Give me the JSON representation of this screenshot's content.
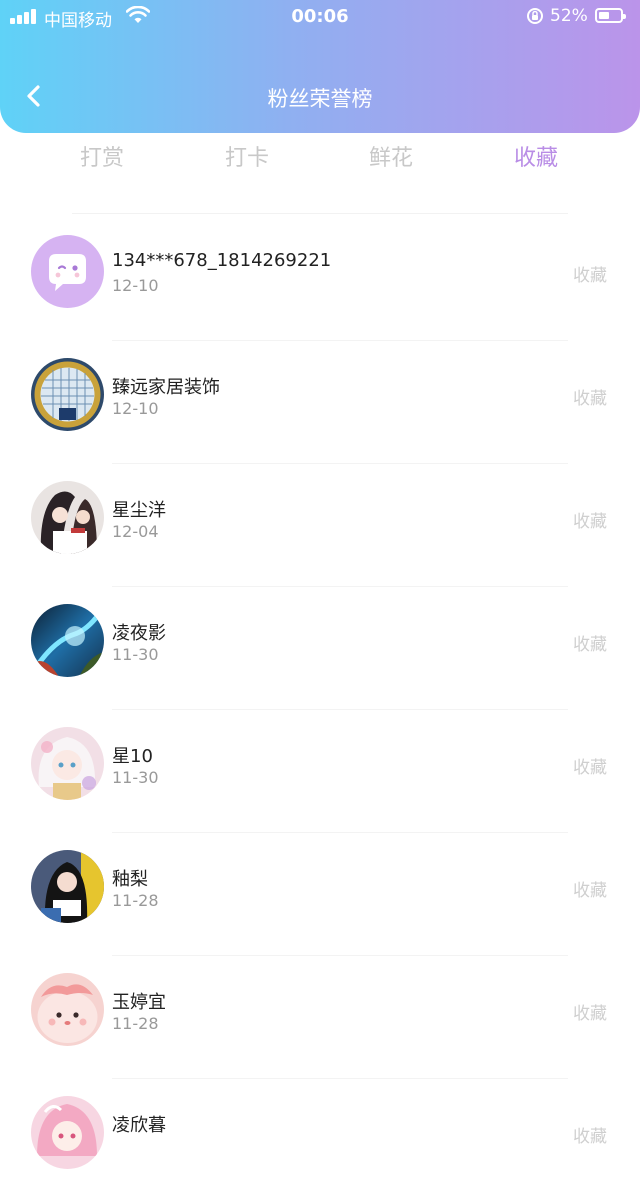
{
  "status_bar": {
    "carrier": "中国移动",
    "time": "00:06",
    "battery_percent": "52%",
    "battery_level": 0.52
  },
  "header": {
    "title": "粉丝荣誉榜",
    "back_icon": "chevron-left-icon"
  },
  "tabs": [
    {
      "label": "打赏",
      "active": false
    },
    {
      "label": "打卡",
      "active": false
    },
    {
      "label": "鲜花",
      "active": false
    },
    {
      "label": "收藏",
      "active": true
    }
  ],
  "fans": [
    {
      "name": "134***678_1814269221",
      "date": "12-10",
      "action": "收藏"
    },
    {
      "name": "臻远家居装饰",
      "date": "12-10",
      "action": "收藏"
    },
    {
      "name": "星尘洋",
      "date": "12-04",
      "action": "收藏"
    },
    {
      "name": "凌夜影",
      "date": "11-30",
      "action": "收藏"
    },
    {
      "name": "星10",
      "date": "11-30",
      "action": "收藏"
    },
    {
      "name": "釉梨",
      "date": "11-28",
      "action": "收藏"
    },
    {
      "name": "玉婷宜",
      "date": "11-28",
      "action": "收藏"
    },
    {
      "name": "凌欣暮",
      "date": "",
      "action": "收藏"
    }
  ],
  "colors": {
    "header_gradient_start": "#5fd2f7",
    "header_gradient_end": "#bb94ea",
    "active_tab": "#b98de6",
    "inactive_tab": "#c8c8c8"
  }
}
